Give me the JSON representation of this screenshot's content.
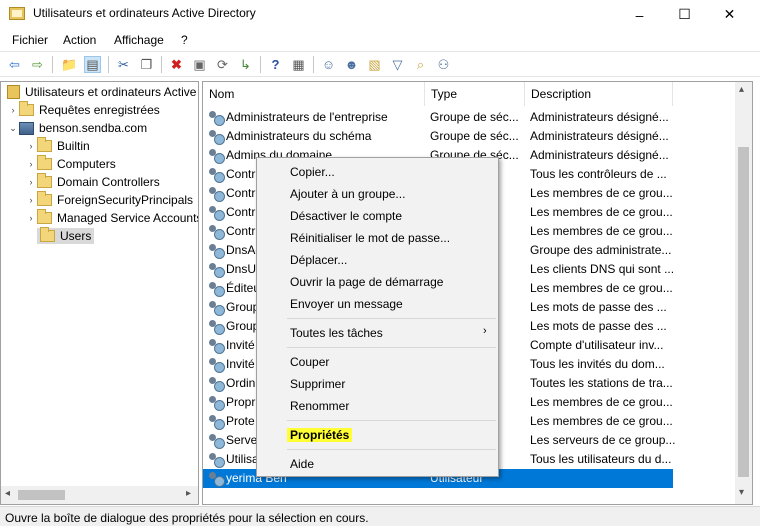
{
  "window": {
    "title": "Utilisateurs et ordinateurs Active Directory"
  },
  "menu": [
    "Fichier",
    "Action",
    "Affichage",
    "?"
  ],
  "tree": {
    "root": "Utilisateurs et ordinateurs Active Directory",
    "saved_queries": "Requêtes enregistrées",
    "domain": "benson.sendba.com",
    "children": [
      "Builtin",
      "Computers",
      "Domain Controllers",
      "ForeignSecurityPrincipals",
      "Managed Service Accounts",
      "Users"
    ]
  },
  "list": {
    "columns": [
      "Nom",
      "Type",
      "Description"
    ],
    "rows": [
      {
        "name": "Administrateurs de l'entreprise",
        "type": "Groupe de séc...",
        "desc": "Administrateurs désigné..."
      },
      {
        "name": "Administrateurs du schéma",
        "type": "Groupe de séc...",
        "desc": "Administrateurs désigné..."
      },
      {
        "name": "Admins du domaine",
        "type": "Groupe de séc...",
        "desc": "Administrateurs désigné..."
      },
      {
        "name": "Contr",
        "type": "",
        "desc": "Tous les contrôleurs de ..."
      },
      {
        "name": "Contr",
        "type": "",
        "desc": "Les membres de ce grou..."
      },
      {
        "name": "Contr",
        "type": "",
        "desc": "Les membres de ce grou..."
      },
      {
        "name": "Contr",
        "type": "",
        "desc": "Les membres de ce grou..."
      },
      {
        "name": "DnsAc",
        "type": "",
        "desc": "Groupe des administrate..."
      },
      {
        "name": "DnsUp",
        "type": "",
        "desc": "Les clients DNS qui sont ..."
      },
      {
        "name": "Éditeu",
        "type": "",
        "desc": "Les membres de ce grou..."
      },
      {
        "name": "Group",
        "type": "",
        "desc": "Les mots de passe des ..."
      },
      {
        "name": "Group",
        "type": "",
        "desc": "Les mots de passe des ..."
      },
      {
        "name": "Invité",
        "type": "",
        "desc": "Compte d'utilisateur inv..."
      },
      {
        "name": "Invité",
        "type": "",
        "desc": "Tous les invités du dom..."
      },
      {
        "name": "Ordin",
        "type": "",
        "desc": "Toutes les stations de tra..."
      },
      {
        "name": "Propr",
        "type": "",
        "desc": "Les membres de ce grou..."
      },
      {
        "name": "Prote",
        "type": "",
        "desc": "Les membres de ce grou..."
      },
      {
        "name": "Server",
        "type": "",
        "desc": "Les serveurs de ce group..."
      },
      {
        "name": "Utilisa",
        "type": "",
        "desc": "Tous les utilisateurs du d..."
      },
      {
        "name": "yerima Ben",
        "type": "Utilisateur",
        "desc": ""
      }
    ]
  },
  "context_menu": {
    "items": [
      "Copier...",
      "Ajouter à un groupe...",
      "Désactiver le compte",
      "Réinitialiser le mot de passe...",
      "Déplacer...",
      "Ouvrir la page de démarrage",
      "Envoyer un message",
      "Toutes les tâches",
      "Couper",
      "Supprimer",
      "Renommer",
      "Propriétés",
      "Aide"
    ]
  },
  "status": {
    "text": "Ouvre la boîte de dialogue des propriétés pour la sélection en cours."
  }
}
